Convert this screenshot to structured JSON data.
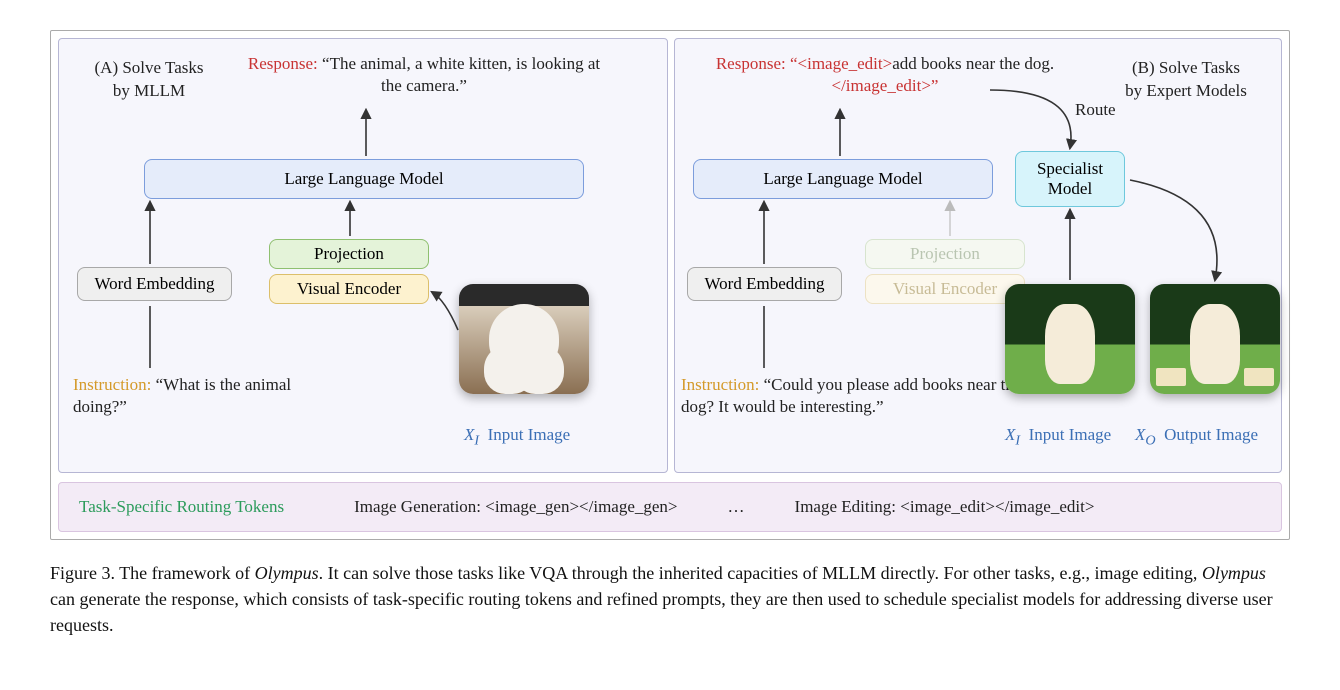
{
  "panelA": {
    "title_l1": "(A) Solve Tasks",
    "title_l2": "by MLLM",
    "response_label": "Response:",
    "response_text": "“The animal, a white kitten, is looking at the camera.”",
    "llm": "Large Language Model",
    "word_embedding": "Word Embedding",
    "projection": "Projection",
    "visual_encoder": "Visual Encoder",
    "instruction_label": "Instruction:",
    "instruction_text": "“What is the animal doing?”",
    "input_image_var": "X",
    "input_image_sub": "I",
    "input_image_label": "Input Image"
  },
  "panelB": {
    "title_l1": "(B) Solve Tasks",
    "title_l2": "by Expert Models",
    "response_label": "Response:",
    "response_tag_open": "“<image_edit>",
    "response_mid": "add books near the dog.",
    "response_tag_close": "</image_edit>”",
    "route": "Route",
    "llm": "Large Language Model",
    "specialist_l1": "Specialist",
    "specialist_l2": "Model",
    "word_embedding": "Word Embedding",
    "projection": "Projection",
    "visual_encoder": "Visual Encoder",
    "instruction_label": "Instruction:",
    "instruction_text": "“Could you please add books near the dog? It would be interesting.”",
    "input_image_var": "X",
    "input_image_sub": "I",
    "input_image_label": "Input Image",
    "output_image_var": "X",
    "output_image_sub": "O",
    "output_image_label": "Output Image"
  },
  "footer": {
    "routing_label": "Task-Specific Routing Tokens",
    "gen": "Image Generation: <image_gen></image_gen>",
    "dots": "…",
    "edit": "Image Editing: <image_edit></image_edit>"
  },
  "caption": {
    "lead": "Figure 3.",
    "text1": " The framework of ",
    "olympus": "Olympus",
    "text2": ". It can solve those tasks like VQA through the inherited capacities of MLLM directly. For other tasks, e.g., image editing, ",
    "text3": " can generate the response, which consists of task-specific routing tokens and refined prompts, they are then used to schedule specialist models for addressing diverse user requests."
  }
}
